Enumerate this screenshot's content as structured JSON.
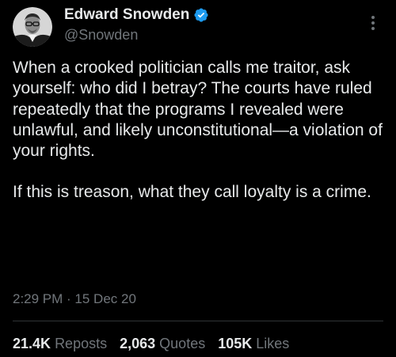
{
  "author": {
    "display_name": "Edward Snowden",
    "handle": "@Snowden",
    "verified": true,
    "verified_color": "#1d9bf0"
  },
  "tweet": {
    "paragraphs": [
      "When a crooked politician calls me traitor, ask yourself: who did I betray? The courts have ruled repeatedly that the programs I revealed were unlawful, and likely unconstitutional—a violation of your rights.",
      "If this is treason, what they call loyalty is a crime."
    ],
    "timestamp": "2:29 PM · 15 Dec 20"
  },
  "stats": {
    "reposts": {
      "count": "21.4K",
      "label": "Reposts"
    },
    "quotes": {
      "count": "2,063",
      "label": "Quotes"
    },
    "likes": {
      "count": "105K",
      "label": "Likes"
    }
  },
  "icons": {
    "avatar": "profile-photo",
    "verified": "verified-badge-icon",
    "more": "more-options-icon"
  },
  "colors": {
    "background": "#000000",
    "text_primary": "#e7e9ea",
    "text_secondary": "#71767b",
    "divider": "#2f3336"
  }
}
